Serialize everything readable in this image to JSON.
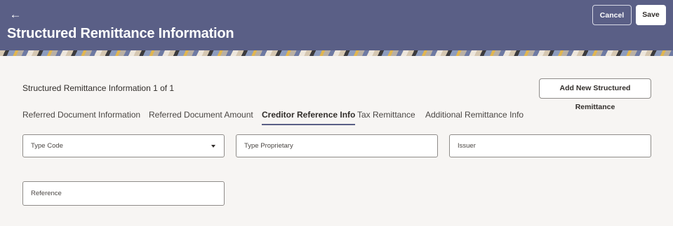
{
  "header": {
    "back_icon": "left-arrow-icon",
    "title": "Structured Remittance Information",
    "cancel_label": "Cancel",
    "save_label": "Save"
  },
  "section": {
    "count_text": "Structured Remittance Information 1 of 1",
    "add_button_label": "Add New Structured Remittance"
  },
  "tabs": [
    {
      "label": "Referred Document Information",
      "active": false
    },
    {
      "label": "Referred Document Amount",
      "active": false
    },
    {
      "label": "Creditor Reference Info",
      "active": true
    },
    {
      "label": "Tax Remittance",
      "active": false
    },
    {
      "label": "Additional Remittance Info",
      "active": false
    }
  ],
  "form": {
    "type_code": {
      "placeholder": "Type Code",
      "value": ""
    },
    "type_proprietary": {
      "placeholder": "Type Proprietary",
      "value": ""
    },
    "issuer": {
      "placeholder": "Issuer",
      "value": ""
    },
    "reference": {
      "placeholder": "Reference",
      "value": ""
    }
  },
  "colors": {
    "header_bg": "#5a5f86",
    "page_bg": "#f7f5f3",
    "tab_underline": "#5a5f86"
  }
}
